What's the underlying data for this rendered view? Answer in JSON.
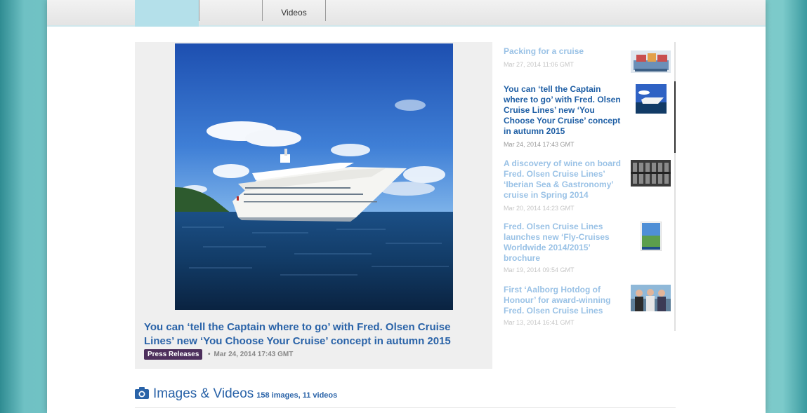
{
  "tabs": [
    {
      "line1": "",
      "line2": "",
      "active": true
    },
    {
      "line1": "",
      "line2": "",
      "active": false
    },
    {
      "line1": "",
      "line2": "Videos",
      "active": false
    },
    {
      "line1": "",
      "line2": "",
      "active": false
    }
  ],
  "feature": {
    "title": "You can ‘tell the Captain where to go’ with Fred. Olsen Cruise Lines’ new ‘You Choose Your Cruise’ concept in autumn 2015",
    "category": "Press Releases",
    "separator": "•",
    "date": "Mar 24, 2014 17:43 GMT"
  },
  "sidebar": {
    "items": [
      {
        "title": "Packing for a cruise",
        "date": "Mar 27, 2014 11:06 GMT",
        "thumb": "suitcases-thumbnail",
        "active": false
      },
      {
        "title": "You can ‘tell the Captain where to go’ with Fred. Olsen Cruise Lines’ new ‘You Choose Your Cruise’ concept in autumn 2015",
        "date": "Mar 24, 2014 17:43 GMT",
        "thumb": "cruise-ship-thumbnail",
        "active": true
      },
      {
        "title": "A discovery of wine on board Fred. Olsen Cruise Lines’ ‘Iberian Sea & Gastronomy’ cruise in Spring 2014",
        "date": "Mar 20, 2014 14:23 GMT",
        "thumb": "wine-cellar-thumbnail",
        "active": false
      },
      {
        "title": "Fred. Olsen Cruise Lines launches new ‘Fly-Cruises Worldwide 2014/2015’ brochure",
        "date": "Mar 19, 2014 09:54 GMT",
        "thumb": "brochure-thumbnail",
        "active": false
      },
      {
        "title": "First ‘Aalborg Hotdog of Honour’ for award-winning Fred. Olsen Cruise Lines",
        "date": "Mar 13, 2014 16:41 GMT",
        "thumb": "people-thumbnail",
        "active": false
      }
    ]
  },
  "media": {
    "title": "Images & Videos",
    "count": "158 images, 11 videos",
    "icon": "camera-icon"
  },
  "colors": {
    "link": "#2a63a8",
    "link_faded": "#9ac2e6",
    "badge": "#4d2f5c",
    "background": "#8fcfd0"
  }
}
